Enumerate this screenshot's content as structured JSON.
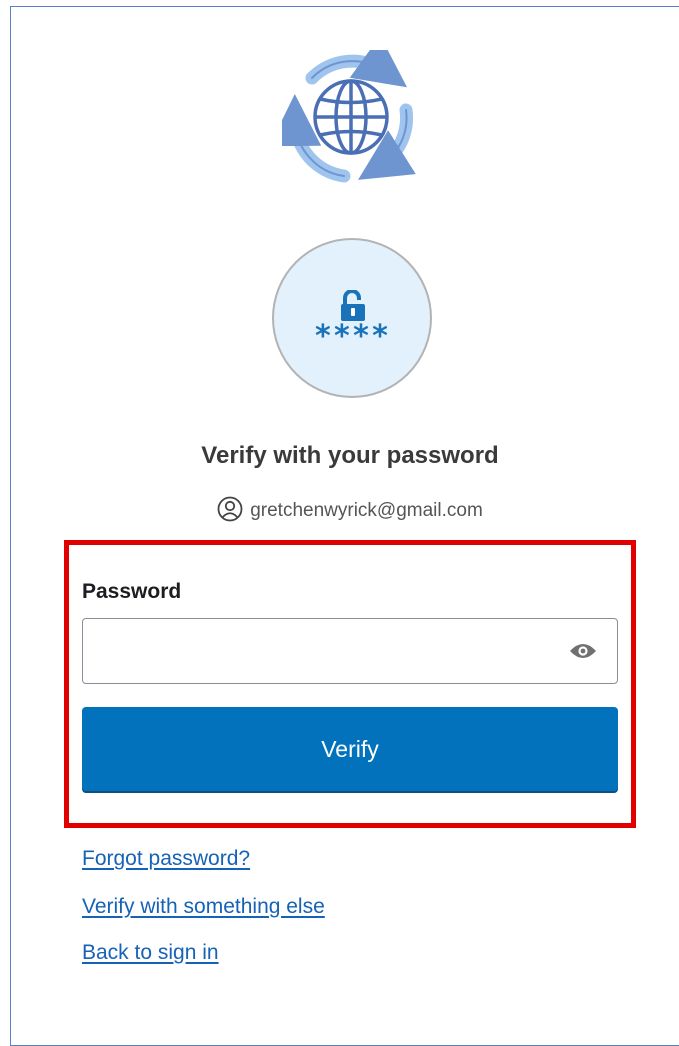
{
  "brand": {
    "logo_icon": "globe-with-circular-arrows-icon"
  },
  "factor": {
    "icon": "password-lock-icon",
    "stars": "****"
  },
  "title": "Verify with your password",
  "identifier": {
    "icon": "user-icon",
    "email": "gretchenwyrick@gmail.com"
  },
  "password": {
    "label": "Password",
    "value": "",
    "placeholder": "",
    "toggle_icon": "eye-icon"
  },
  "verify_button": {
    "label": "Verify"
  },
  "links": {
    "forgot_password": "Forgot password?",
    "verify_with_something_else": "Verify with something else",
    "back_to_sign_in": "Back to sign in"
  },
  "colors": {
    "primary": "#0172bb",
    "link": "#1662b7",
    "highlight": "#e00000",
    "icon_blue": "#1a73b8",
    "icon_bg": "#e2f1fc"
  }
}
